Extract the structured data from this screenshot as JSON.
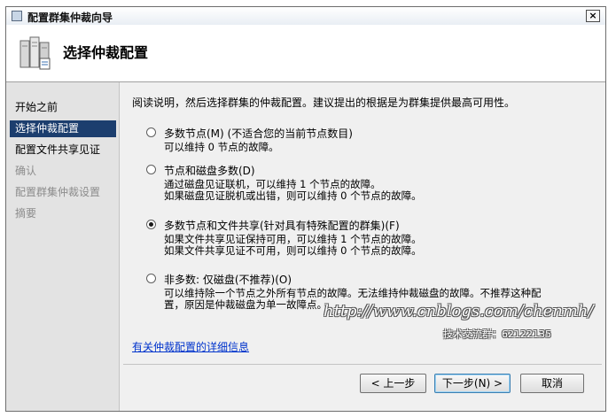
{
  "window": {
    "title": "配置群集仲裁向导",
    "close_icon": "×"
  },
  "header": {
    "title": "选择仲裁配置"
  },
  "nav": {
    "items": [
      {
        "label": "开始之前"
      },
      {
        "label": "选择仲裁配置"
      },
      {
        "label": "配置文件共享见证"
      },
      {
        "label": "确认"
      },
      {
        "label": "配置群集仲裁设置"
      },
      {
        "label": "摘要"
      }
    ]
  },
  "main": {
    "intro": "阅读说明，然后选择群集的仲裁配置。建议提出的根据是为群集提供最高可用性。",
    "options": [
      {
        "label": "多数节点(M) (不适合您的当前节点数目)",
        "desc": [
          "可以维持 0 节点的故障。"
        ]
      },
      {
        "label": "节点和磁盘多数(D)",
        "desc": [
          "通过磁盘见证联机，可以维持 1 个节点的故障。",
          "如果磁盘见证脱机或出错，则可以维持 0 个节点的故障。"
        ]
      },
      {
        "label": "多数节点和文件共享(针对具有特殊配置的群集)(F)",
        "desc": [
          "如果文件共享见证保持可用，可以维持 1 个节点的故障。",
          "如果文件共享见证不可用，则可以维持 0 个节点的故障。"
        ]
      },
      {
        "label": "非多数: 仅磁盘(不推荐)(O)",
        "desc": [
          "可以维持除一个节点之外所有节点的故障。无法维持仲裁磁盘的故障。不推荐这种配",
          "置，原因是仲裁磁盘为单一故障点。"
        ]
      }
    ],
    "selected_option": 2,
    "link": "有关仲裁配置的详细信息",
    "watermark": "http://www.cnblogs.com/chenmh/",
    "watermark2": "技术交流群：62122135"
  },
  "buttons": {
    "back": "< 上一步",
    "next": "下一步(N) >",
    "cancel": "取消"
  }
}
